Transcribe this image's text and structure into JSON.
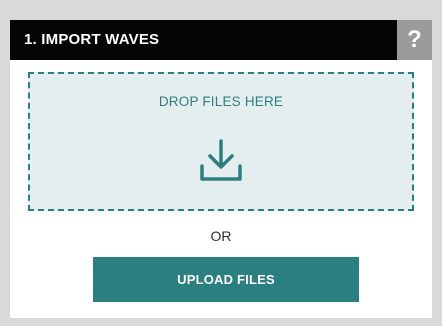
{
  "header": {
    "title": "1. IMPORT WAVES",
    "help_label": "?"
  },
  "dropzone": {
    "label": "DROP FILES HERE",
    "icon": "download-icon"
  },
  "separator": {
    "label": "OR"
  },
  "upload": {
    "label": "UPLOAD FILES"
  },
  "colors": {
    "accent": "#2b7f80",
    "header_bg": "#050505",
    "help_bg": "#9b9b9b",
    "dropzone_bg": "#e5eeef",
    "page_bg": "#d9d9d9"
  }
}
